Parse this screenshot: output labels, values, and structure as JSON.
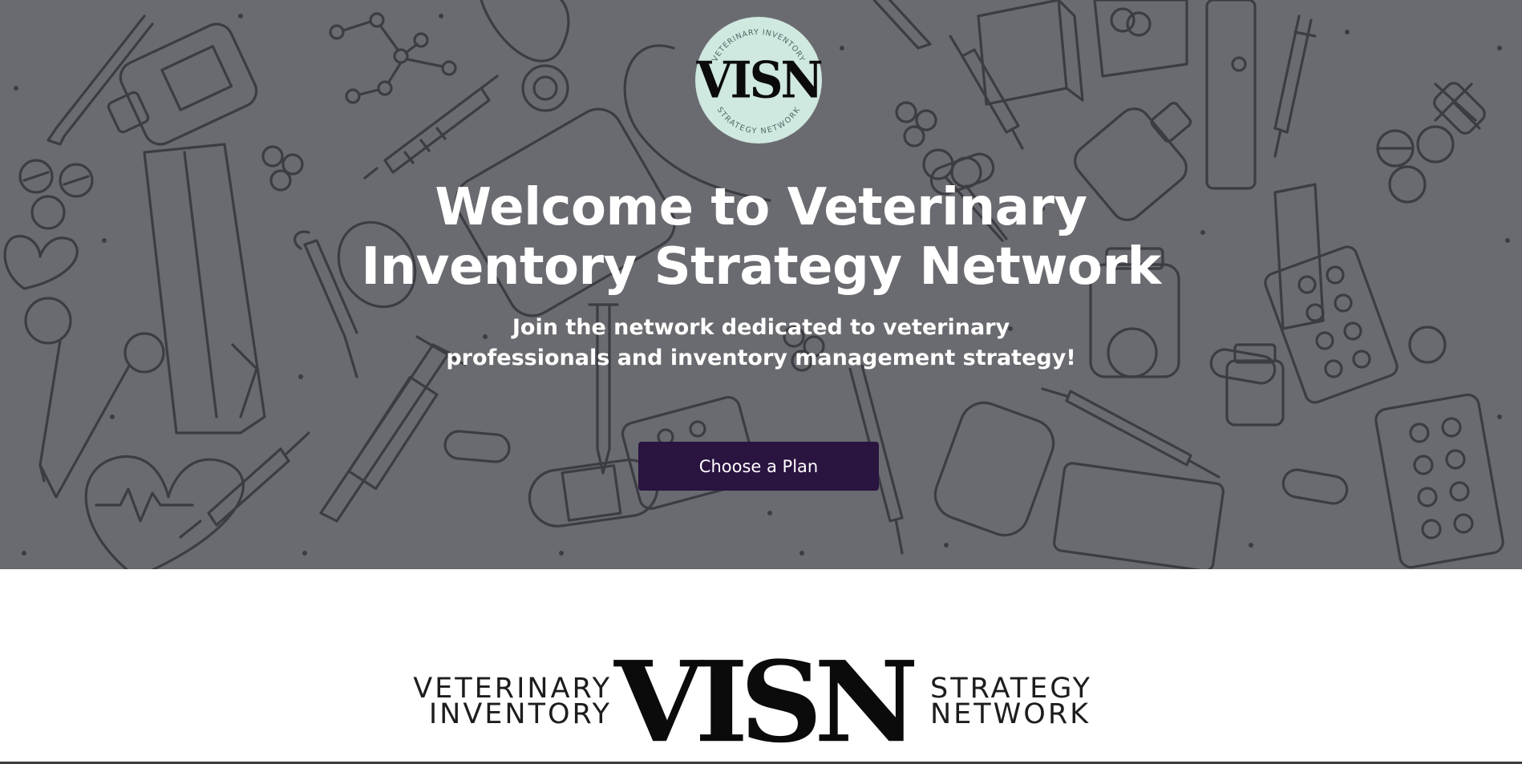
{
  "hero": {
    "background_color": "#6a6b70",
    "badge": {
      "logo_text": "VISN",
      "ring_text_top": "VETERINARY INVENTORY",
      "ring_text_bottom": "STRATEGY NETWORK",
      "background_color": "#cfe8e0"
    },
    "title": "Welcome to Veterinary Inventory Strategy Network",
    "subtitle": "Join the network dedicated to veterinary professionals and inventory management strategy!",
    "cta_label": "Choose a Plan",
    "cta_color": "#2a1440"
  },
  "brand_lockup": {
    "left_line_1": "VETERINARY",
    "left_line_2": "INVENTORY",
    "mark": "VISN",
    "right_line_1": "STRATEGY",
    "right_line_2": "NETWORK"
  },
  "icons": [
    "syringe-icon",
    "pill-bottle-icon",
    "stethoscope-icon",
    "thermometer-icon",
    "pill-icon",
    "heart-icon",
    "bandage-icon",
    "blister-pack-icon",
    "molecule-icon",
    "cross-icon"
  ]
}
